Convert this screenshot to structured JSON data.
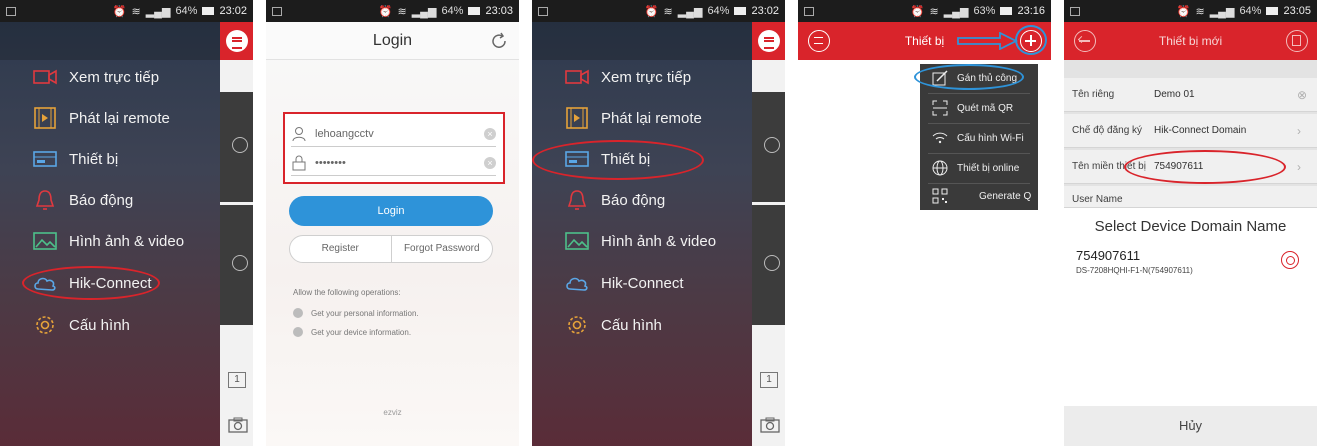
{
  "status_bars": [
    {
      "time": "23:02",
      "battery": "64%"
    },
    {
      "time": "23:03",
      "battery": "64%"
    },
    {
      "time": "23:02",
      "battery": "64%"
    },
    {
      "time": "23:16",
      "battery": "63%"
    },
    {
      "time": "23:05",
      "battery": "64%"
    }
  ],
  "drawer_menu": {
    "items": [
      {
        "label": "Xem trực tiếp",
        "icon": "camera-icon"
      },
      {
        "label": "Phát lại remote",
        "icon": "film-icon"
      },
      {
        "label": "Thiết bị",
        "icon": "dvr-icon"
      },
      {
        "label": "Báo động",
        "icon": "bell-icon"
      },
      {
        "label": "Hình ảnh & video",
        "icon": "image-icon"
      },
      {
        "label": "Hik-Connect",
        "icon": "cloud-icon"
      },
      {
        "label": "Cấu hình",
        "icon": "gear-icon"
      }
    ],
    "side_box": "1"
  },
  "login": {
    "title": "Login",
    "username": "lehoangcctv",
    "password": "••••••••",
    "login_button": "Login",
    "register": "Register",
    "forgot": "Forgot Password",
    "allow_title": "Allow the following operations:",
    "allow_items": [
      "Get your personal information.",
      "Get your device information."
    ],
    "footer": "ezviz"
  },
  "devices": {
    "title": "Thiết bị",
    "popup": [
      {
        "label": "Gán thủ công",
        "icon": "edit-icon"
      },
      {
        "label": "Quét mã QR",
        "icon": "scan-icon"
      },
      {
        "label": "Cấu hình Wi-Fi",
        "icon": "wifi-icon"
      },
      {
        "label": "Thiết bị online",
        "icon": "globe-icon"
      },
      {
        "label": "Generate Q",
        "icon": "qr-icon"
      }
    ]
  },
  "new_device": {
    "title": "Thiết bị mới",
    "rows": [
      {
        "label": "Tên riêng",
        "value": "Demo 01"
      },
      {
        "label": "Chế độ đăng ký",
        "value": "Hik-Connect Domain"
      },
      {
        "label": "Tên miền thiết bị",
        "value": "754907611"
      },
      {
        "label": "User Name",
        "value": ""
      }
    ],
    "sheet_title": "Select Device Domain Name",
    "option_id": "754907611",
    "option_sub": "DS-7208HQHI-F1-N(754907611)",
    "cancel": "Hủy"
  },
  "colors": {
    "accent_red": "#d9242b",
    "login_blue": "#2e93d9",
    "annotation_blue": "#2e93d9"
  }
}
